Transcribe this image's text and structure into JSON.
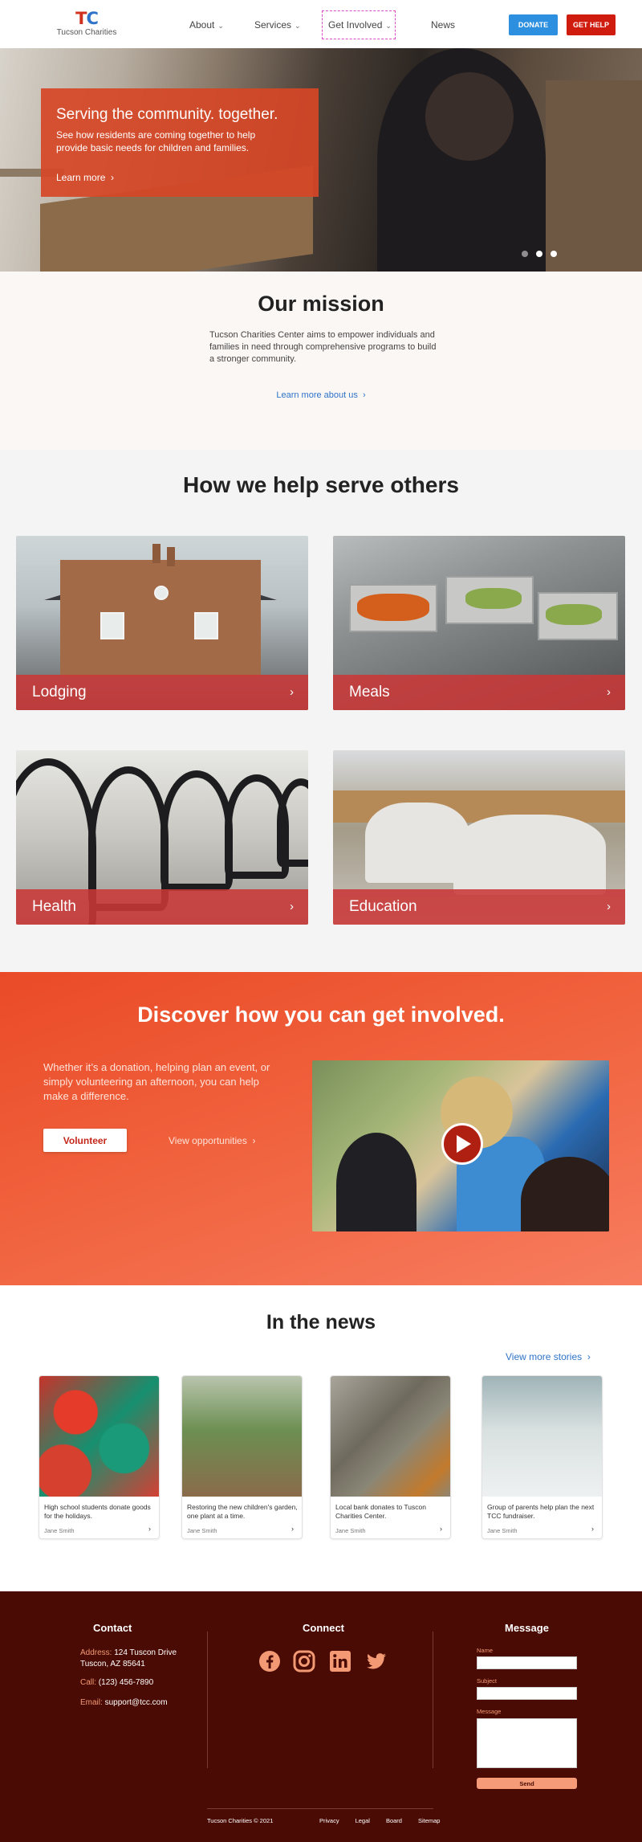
{
  "nav": {
    "logo_letters": "TC",
    "logo_text": "Tucson Charities",
    "links": [
      {
        "label": "About",
        "chevron": "chevron-down-icon"
      },
      {
        "label": "Services",
        "chevron": "chevron-down-icon"
      },
      {
        "label": "Get Involved",
        "chevron": "chevron-down-icon"
      },
      {
        "label": "News"
      }
    ],
    "donate_label": "DONATE",
    "help_label": "GET HELP"
  },
  "hero": {
    "title": "Serving the community. together.",
    "subtitle": "See how residents are coming together to help provide basic needs for children and families.",
    "link_label": "Learn more",
    "slides": 3,
    "active_slide": 1
  },
  "mission": {
    "title": "Our mission",
    "text": "Tucson Charities Center aims to empower individuals and families in need through comprehensive programs to build a stronger community.",
    "link_label": "Learn more about us"
  },
  "services": {
    "title": "How we help serve others",
    "items": [
      {
        "label": "Lodging"
      },
      {
        "label": "Meals"
      },
      {
        "label": "Health"
      },
      {
        "label": "Education"
      }
    ]
  },
  "involved": {
    "title": "Discover how you can get involved.",
    "text": "Whether it’s a donation, helping plan an event, or simply volunteering an afternoon, you can help make a difference.",
    "volunteer_label": "Volunteer",
    "link_label": "View opportunities"
  },
  "news": {
    "title": "In the news",
    "more_label": "View more stories",
    "cards": [
      {
        "text": "High school students donate goods for the holidays.",
        "author": "Jane Smith"
      },
      {
        "text": "Restoring the new children's garden, one plant at a time.",
        "author": "Jane Smith"
      },
      {
        "text": "Local bank donates to Tuscon Charities Center.",
        "author": "Jane Smith"
      },
      {
        "text": "Group of parents help plan the next TCC fundraiser.",
        "author": "Jane Smith"
      }
    ]
  },
  "footer": {
    "contact_title": "Contact",
    "address_key": "Address:",
    "address_line1": "124 Tuscon Drive",
    "address_line2": "Tuscon, AZ 85641",
    "call_key": "Call:",
    "call_value": "(123) 456-7890",
    "email_key": "Email:",
    "email_value": "support@tcc.com",
    "connect_title": "Connect",
    "social": [
      "facebook-icon",
      "instagram-icon",
      "linkedin-icon",
      "twitter-icon"
    ],
    "message_title": "Message",
    "name_label": "Name",
    "subject_label": "Subject",
    "message_label": "Message",
    "send_label": "Send",
    "copyright": "Tucson Charities © 2021",
    "links": [
      "Privacy",
      "Legal",
      "Board",
      "Sitemap"
    ]
  },
  "colors": {
    "brand_red": "#d01c0e",
    "brand_blue": "#2d8fe0",
    "accent_orange": "#ea4a27",
    "footer_bg": "#4a0b04",
    "footer_accent": "#f39a74"
  }
}
